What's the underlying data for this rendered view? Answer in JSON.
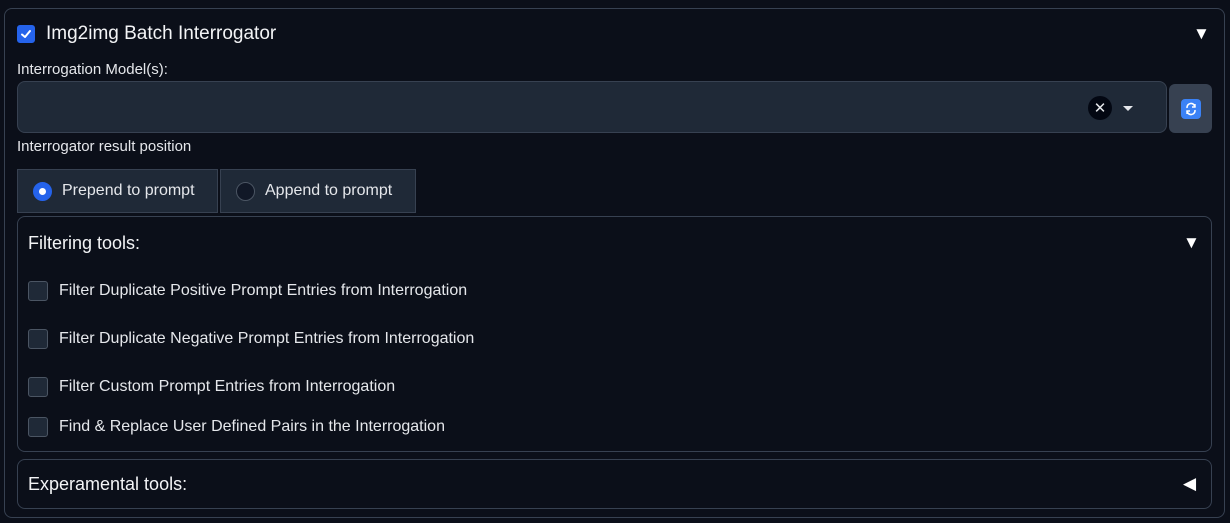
{
  "header": {
    "title": "Img2img Batch Interrogator",
    "enabled": true,
    "collapse_icon": "triangle-down-icon"
  },
  "model_field": {
    "label": "Interrogation Model(s):",
    "value": "",
    "clear_icon": "close-icon",
    "open_icon": "caret-down-icon",
    "refresh_icon": "refresh-icon"
  },
  "result_position": {
    "label": "Interrogator result position",
    "options": [
      {
        "label": "Prepend to prompt",
        "selected": true
      },
      {
        "label": "Append to prompt",
        "selected": false
      }
    ]
  },
  "filtering": {
    "title": "Filtering tools:",
    "expanded": true,
    "items": [
      {
        "label": "Filter Duplicate Positive Prompt Entries from Interrogation",
        "checked": false
      },
      {
        "label": "Filter Duplicate Negative Prompt Entries from Interrogation",
        "checked": false
      },
      {
        "label": "Filter Custom Prompt Entries from Interrogation",
        "checked": false
      },
      {
        "label": "Find & Replace User Defined Pairs in the Interrogation",
        "checked": false
      }
    ]
  },
  "experimental": {
    "title": "Experamental tools:",
    "expanded": false
  },
  "colors": {
    "background": "#0b0f19",
    "accent": "#2563eb",
    "field": "#1f2937",
    "border": "#374151"
  }
}
